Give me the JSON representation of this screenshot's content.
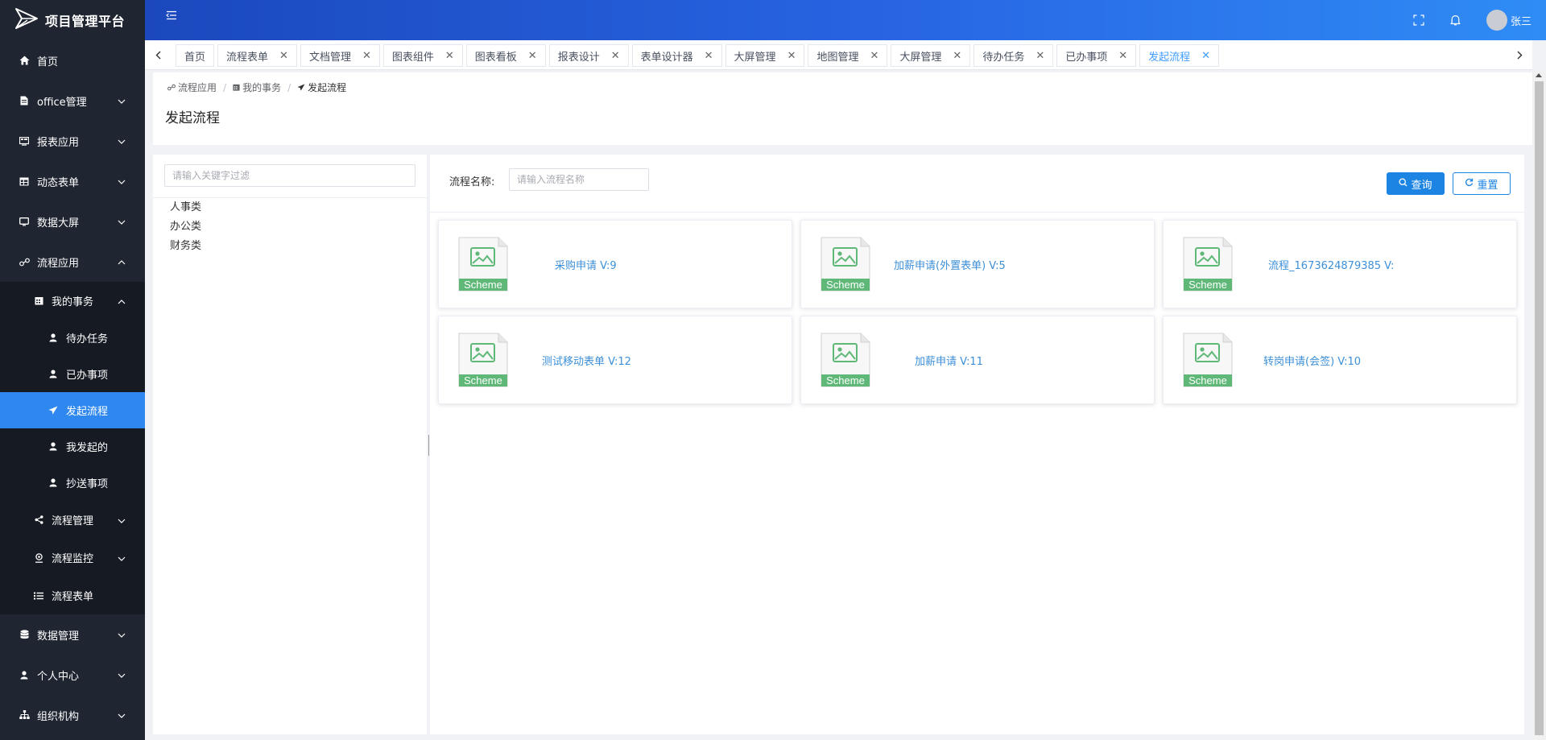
{
  "app": {
    "title": "项目管理平台"
  },
  "header": {
    "user_name": "张三"
  },
  "sidebar": {
    "items": [
      {
        "label": "首页",
        "icon": "home-icon"
      },
      {
        "label": "office管理",
        "icon": "file-icon"
      },
      {
        "label": "报表应用",
        "icon": "report-icon"
      },
      {
        "label": "动态表单",
        "icon": "table-icon"
      },
      {
        "label": "数据大屏",
        "icon": "monitor-icon"
      },
      {
        "label": "流程应用",
        "icon": "flow-icon"
      },
      {
        "label": "我的事务",
        "icon": "calendar-icon"
      },
      {
        "label": "待办任务",
        "icon": "user-icon"
      },
      {
        "label": "已办事项",
        "icon": "user-icon"
      },
      {
        "label": "发起流程",
        "icon": "send-icon"
      },
      {
        "label": "我发起的",
        "icon": "user-icon"
      },
      {
        "label": "抄送事项",
        "icon": "user-icon"
      },
      {
        "label": "流程管理",
        "icon": "share-icon"
      },
      {
        "label": "流程监控",
        "icon": "monitor-pin-icon"
      },
      {
        "label": "流程表单",
        "icon": "list-icon"
      },
      {
        "label": "数据管理",
        "icon": "database-icon"
      },
      {
        "label": "个人中心",
        "icon": "user-icon"
      },
      {
        "label": "组织机构",
        "icon": "org-icon"
      }
    ]
  },
  "tabs": [
    {
      "label": "首页"
    },
    {
      "label": "流程表单"
    },
    {
      "label": "文档管理"
    },
    {
      "label": "图表组件"
    },
    {
      "label": "图表看板"
    },
    {
      "label": "报表设计"
    },
    {
      "label": "表单设计器"
    },
    {
      "label": "大屏管理"
    },
    {
      "label": "地图管理"
    },
    {
      "label": "大屏管理"
    },
    {
      "label": "待办任务"
    },
    {
      "label": "已办事项"
    },
    {
      "label": "发起流程"
    }
  ],
  "breadcrumb": [
    "流程应用",
    "我的事务",
    "发起流程"
  ],
  "page": {
    "title": "发起流程"
  },
  "tree": {
    "filter_placeholder": "请输入关键字过滤",
    "nodes": [
      "人事类",
      "办公类",
      "财务类"
    ]
  },
  "search": {
    "name_label": "流程名称:",
    "name_placeholder": "请输入流程名称",
    "query_label": "查询",
    "reset_label": "重置"
  },
  "cards": [
    {
      "title": "采购申请 V:9",
      "icon_label": "Scheme"
    },
    {
      "title": "加薪申请(外置表单) V:5",
      "icon_label": "Scheme"
    },
    {
      "title": "流程_1673624879385 V:",
      "icon_label": "Scheme"
    },
    {
      "title": "测试移动表单 V:12",
      "icon_label": "Scheme"
    },
    {
      "title": "加薪申请 V:11",
      "icon_label": "Scheme"
    },
    {
      "title": "转岗申请(会签) V:10",
      "icon_label": "Scheme"
    }
  ],
  "colors": {
    "sidebar_bg": "#1f2531",
    "sidebar_active": "#2f88f0",
    "header_gradient_start": "#1b48bd",
    "header_gradient_end": "#2f8cf5",
    "accent": "#1c84e2",
    "scheme_green": "#5fb878"
  }
}
